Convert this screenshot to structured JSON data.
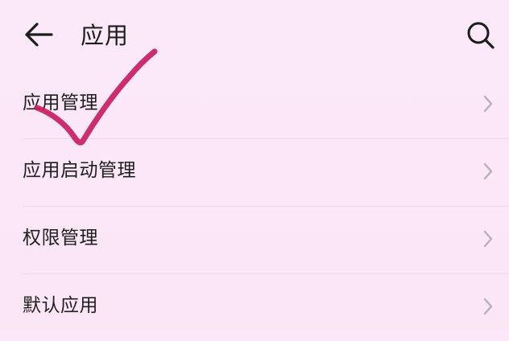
{
  "header": {
    "title": "应用",
    "back_icon": "arrow-left-icon",
    "search_icon": "search-icon"
  },
  "list": {
    "items": [
      {
        "label": "应用管理",
        "chevron_icon": "chevron-right-icon"
      },
      {
        "label": "应用启动管理",
        "chevron_icon": "chevron-right-icon"
      },
      {
        "label": "权限管理",
        "chevron_icon": "chevron-right-icon"
      },
      {
        "label": "默认应用",
        "chevron_icon": "chevron-right-icon"
      }
    ]
  },
  "annotation": {
    "icon": "checkmark-annotation",
    "color": "#c8185a"
  },
  "colors": {
    "background": "#fbe7f7",
    "text": "#1c1c1c",
    "chevron": "#b8b0b6"
  }
}
